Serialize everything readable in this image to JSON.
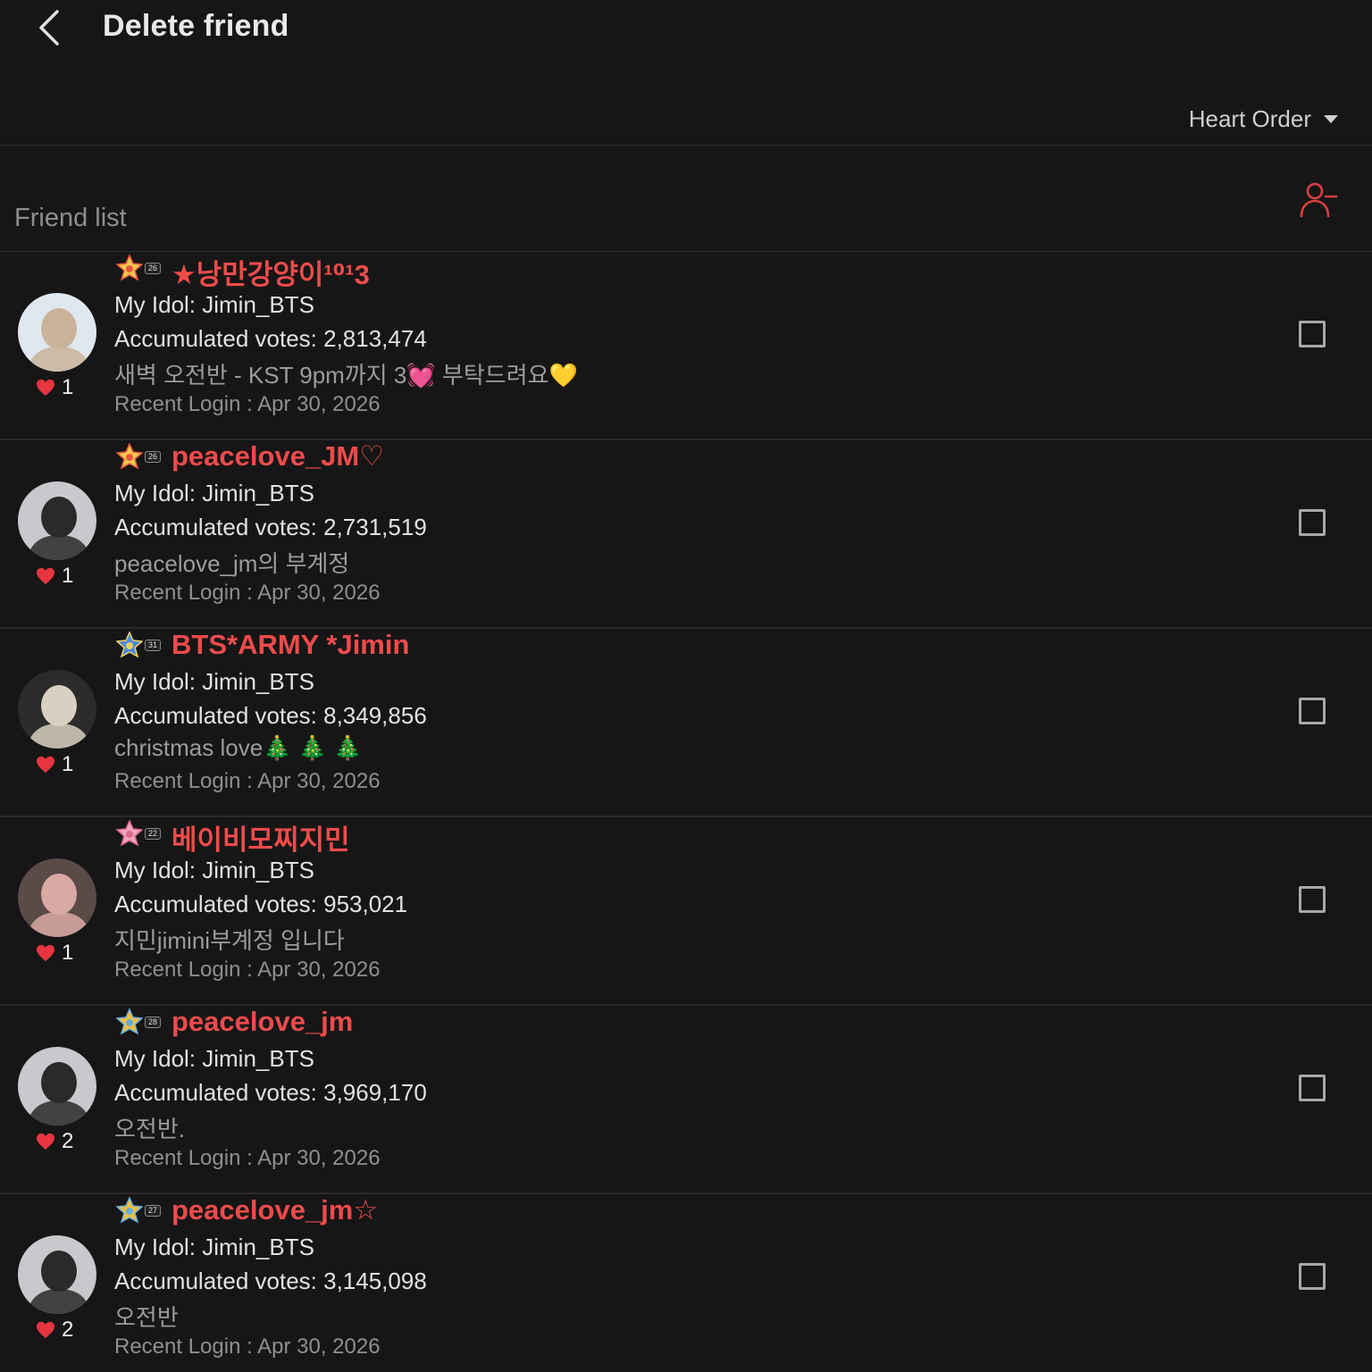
{
  "header": {
    "title": "Delete friend"
  },
  "sort": {
    "label": "Heart Order"
  },
  "section": {
    "label": "Friend list"
  },
  "colors": {
    "background": "#161616",
    "accent": "#ee4b4b",
    "heart": "#e8353f"
  },
  "friends": [
    {
      "badge_level": "26",
      "badge_icon": "star-burst-badge-icon",
      "nickname": "★낭만강양이¹⁰¹3",
      "idol": "My Idol: Jimin_BTS",
      "votes": "Accumulated votes: 2,813,474",
      "status": "새벽 오전반 - KST 9pm까지 3💓 부탁드려요💛",
      "login": "Recent Login : Apr 30, 2026",
      "hearts": "1",
      "avatar_bg": "#dfe8f0",
      "avatar_fg": "#c9b49a"
    },
    {
      "badge_level": "26",
      "badge_icon": "star-burst-badge-icon",
      "nickname": "peacelove_JM♡",
      "idol": "My Idol: Jimin_BTS",
      "votes": "Accumulated votes: 2,731,519",
      "status": "peacelove_jm의 부계정",
      "login": "Recent Login : Apr 30, 2026",
      "hearts": "1",
      "avatar_bg": "#c7c9cc",
      "avatar_fg": "#2a2a2a"
    },
    {
      "badge_level": "31",
      "badge_icon": "blue-crest-badge-icon",
      "nickname": "BTS*ARMY *Jimin",
      "idol": "My Idol: Jimin_BTS",
      "votes": "Accumulated votes: 8,349,856",
      "status": "christmas love🎄 🎄 🎄",
      "login": "Recent Login : Apr 30, 2026",
      "hearts": "1",
      "avatar_bg": "#2b2b2b",
      "avatar_fg": "#d8d0c0"
    },
    {
      "badge_level": "22",
      "badge_icon": "pink-trophy-badge-icon",
      "nickname": "베이비모찌지민",
      "idol": "My Idol: Jimin_BTS",
      "votes": "Accumulated votes: 953,021",
      "status": "지민jimini부계정 입니다",
      "login": "Recent Login : Apr 30, 2026",
      "hearts": "1",
      "avatar_bg": "#5a4a48",
      "avatar_fg": "#d9a9a4"
    },
    {
      "badge_level": "28",
      "badge_icon": "flower-crest-badge-icon",
      "nickname": "peacelove_jm",
      "idol": "My Idol: Jimin_BTS",
      "votes": "Accumulated votes: 3,969,170",
      "status": "오전반.",
      "login": "Recent Login : Apr 30, 2026",
      "hearts": "2",
      "avatar_bg": "#c7c9cc",
      "avatar_fg": "#2a2a2a"
    },
    {
      "badge_level": "27",
      "badge_icon": "flower-crest-badge-icon",
      "nickname": "peacelove_jm☆",
      "idol": "My Idol: Jimin_BTS",
      "votes": "Accumulated votes: 3,145,098",
      "status": "오전반",
      "login": "Recent Login : Apr 30, 2026",
      "hearts": "2",
      "avatar_bg": "#c7c9cc",
      "avatar_fg": "#2a2a2a"
    }
  ]
}
